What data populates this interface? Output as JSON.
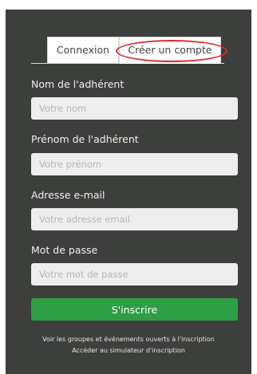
{
  "tabs": {
    "login_label": "Connexion",
    "signup_label": "Créer un compte"
  },
  "form": {
    "last_name": {
      "label": "Nom de l'adhérent",
      "placeholder": "Votre nom",
      "value": ""
    },
    "first_name": {
      "label": "Prénom de l'adhérent",
      "placeholder": "Votre prénom",
      "value": ""
    },
    "email": {
      "label": "Adresse e-mail",
      "placeholder": "Votre adresse email",
      "value": ""
    },
    "password": {
      "label": "Mot de passe",
      "placeholder": "Votre mot de passe",
      "value": ""
    },
    "submit_label": "S'inscrire"
  },
  "footer": {
    "groups_link": "Voir les groupes et événements ouverts à l'inscription",
    "simulator_link": "Accéder au simulateur d'inscription"
  },
  "colors": {
    "panel_background": "#3c3f3b",
    "submit_button": "#2e9e45",
    "highlight_circle": "#e02b2b",
    "input_background": "#eeeeee"
  }
}
